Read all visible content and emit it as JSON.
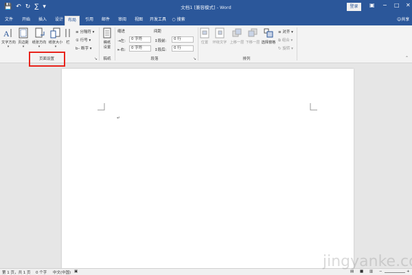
{
  "window": {
    "title": "文档1 [兼容模式] - Word",
    "login_label": "登录",
    "share_label": "共享"
  },
  "tabs": [
    "文件",
    "开始",
    "插入",
    "设计",
    "布局",
    "引用",
    "邮件",
    "审阅",
    "视图",
    "开发工具",
    "搜索"
  ],
  "active_tab": "布局",
  "ribbon": {
    "page_setup": {
      "label": "页面设置",
      "text_direction": "文字方向",
      "margins": "页边距",
      "orientation": "纸张方向",
      "size": "纸张大小",
      "columns": "栏",
      "breaks": "分隔符",
      "line_numbers": "行号",
      "hyphenation": "断字"
    },
    "draft": {
      "label": "稿纸",
      "button_line1": "稿纸",
      "button_line2": "设置"
    },
    "paragraph": {
      "label": "段落",
      "indent_header": "缩进",
      "spacing_header": "间距",
      "left_label": "左:",
      "left_value": "0 字符",
      "right_label": "右:",
      "right_value": "0 字符",
      "before_label": "段前:",
      "before_value": "0 行",
      "after_label": "段后:",
      "after_value": "0 行"
    },
    "arrange": {
      "label": "排列",
      "position": "位置",
      "wrap_text": "环绕文字",
      "bring_forward": "上移一层",
      "send_backward": "下移一层",
      "selection_pane": "选择窗格",
      "align": "对齐",
      "group": "组合",
      "rotate": "旋转"
    }
  },
  "status": {
    "page": "第 1 页，共 1 页",
    "words": "0 个字",
    "language": "中文(中国)"
  },
  "document": {
    "paragraph_mark": "↵"
  },
  "watermark": "jingyanke.com"
}
